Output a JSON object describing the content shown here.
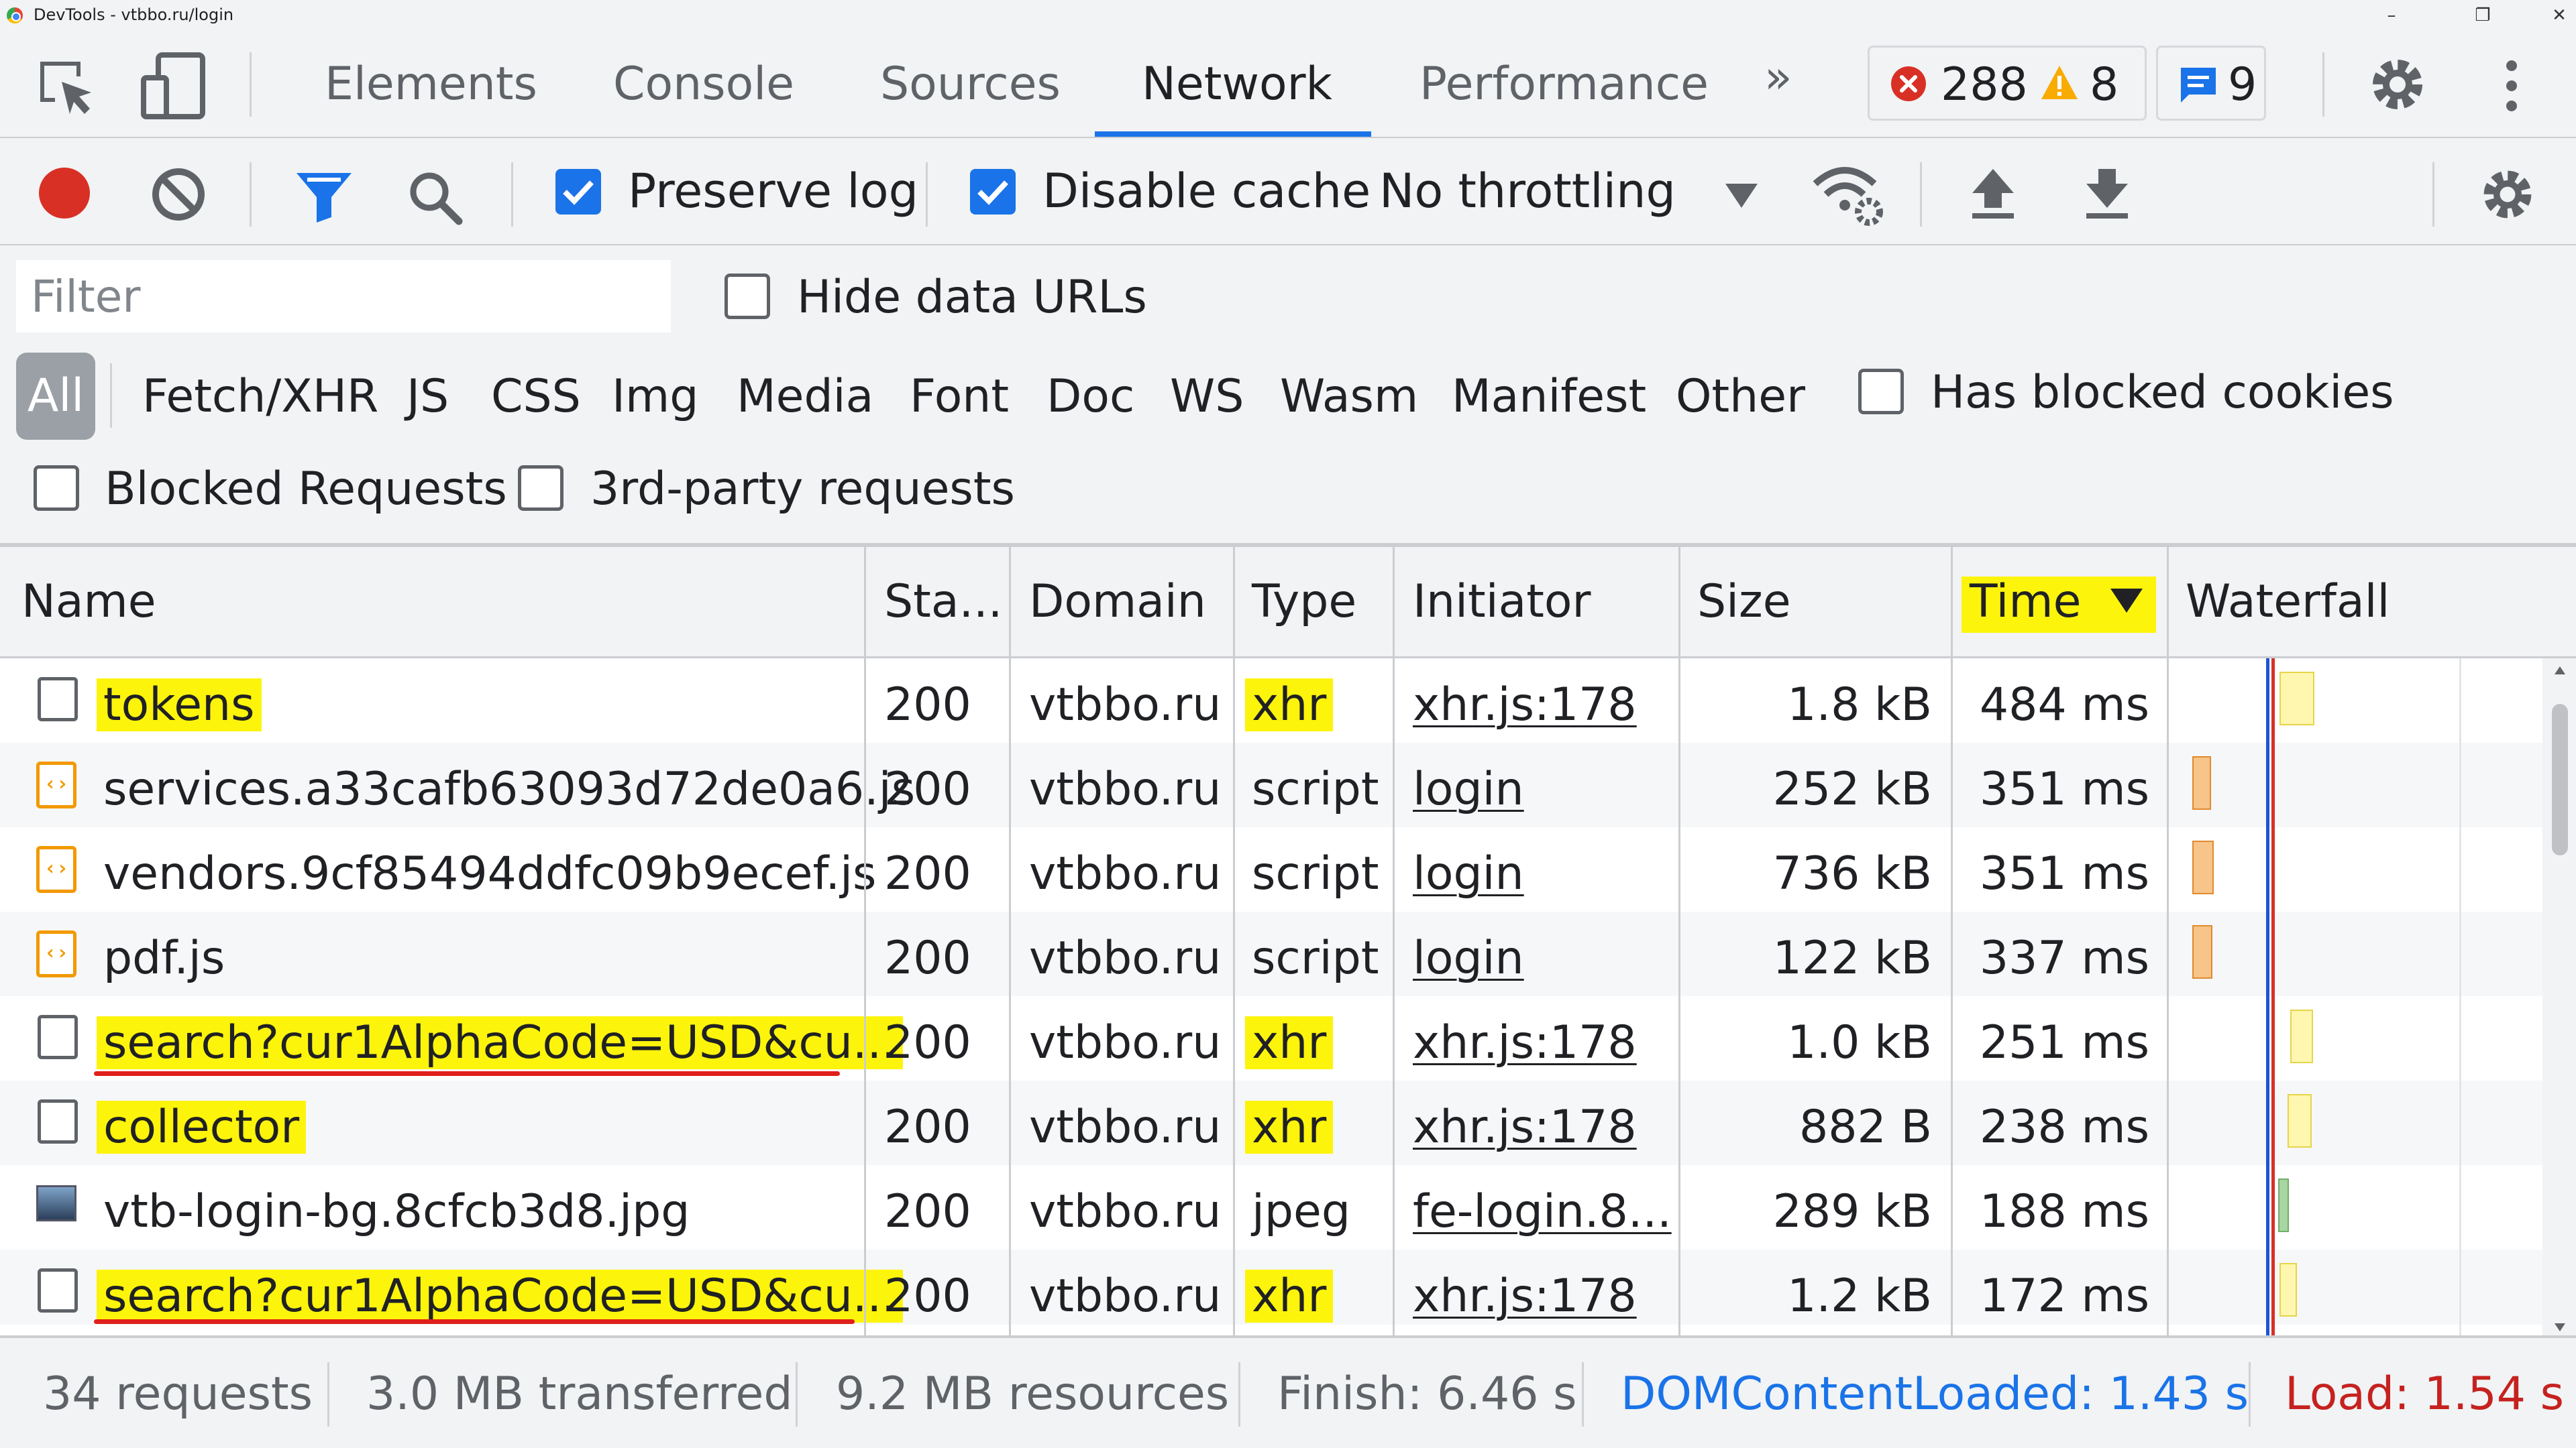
{
  "window": {
    "title": "DevTools - vtbbo.ru/login"
  },
  "tabs": {
    "elements": "Elements",
    "console": "Console",
    "sources": "Sources",
    "network": "Network",
    "performance": "Performance",
    "more": "»"
  },
  "badges": {
    "errors": "288",
    "warnings": "8",
    "messages": "9"
  },
  "toolbar": {
    "preserve_log": "Preserve log",
    "disable_cache": "Disable cache",
    "throttling": "No throttling"
  },
  "filter": {
    "placeholder": "Filter",
    "hide_data_urls": "Hide data URLs",
    "types": [
      "All",
      "Fetch/XHR",
      "JS",
      "CSS",
      "Img",
      "Media",
      "Font",
      "Doc",
      "WS",
      "Wasm",
      "Manifest",
      "Other"
    ],
    "has_blocked_cookies": "Has blocked cookies",
    "blocked_requests": "Blocked Requests",
    "third_party": "3rd-party requests"
  },
  "columns": {
    "name": "Name",
    "status": "Sta...",
    "domain": "Domain",
    "type": "Type",
    "initiator": "Initiator",
    "size": "Size",
    "time": "Time",
    "waterfall": "Waterfall"
  },
  "rows": [
    {
      "name": "tokens",
      "status": "200",
      "domain": "vtbbo.ru",
      "type": "xhr",
      "initiator": "xhr.js:178",
      "size": "1.8 kB",
      "time": "484 ms"
    },
    {
      "name": "services.a33cafb63093d72de0a6.js",
      "status": "200",
      "domain": "vtbbo.ru",
      "type": "script",
      "initiator": "login",
      "size": "252 kB",
      "time": "351 ms"
    },
    {
      "name": "vendors.9cf85494ddfc09b9ecef.js",
      "status": "200",
      "domain": "vtbbo.ru",
      "type": "script",
      "initiator": "login",
      "size": "736 kB",
      "time": "351 ms"
    },
    {
      "name": "pdf.js",
      "status": "200",
      "domain": "vtbbo.ru",
      "type": "script",
      "initiator": "login",
      "size": "122 kB",
      "time": "337 ms"
    },
    {
      "name": "search?cur1AlphaCode=USD&cu...",
      "status": "200",
      "domain": "vtbbo.ru",
      "type": "xhr",
      "initiator": "xhr.js:178",
      "size": "1.0 kB",
      "time": "251 ms"
    },
    {
      "name": "collector",
      "status": "200",
      "domain": "vtbbo.ru",
      "type": "xhr",
      "initiator": "xhr.js:178",
      "size": "882 B",
      "time": "238 ms"
    },
    {
      "name": "vtb-login-bg.8cfcb3d8.jpg",
      "status": "200",
      "domain": "vtbbo.ru",
      "type": "jpeg",
      "initiator": "fe-login.8...",
      "size": "289 kB",
      "time": "188 ms"
    },
    {
      "name": "search?cur1AlphaCode=USD&cu...",
      "status": "200",
      "domain": "vtbbo.ru",
      "type": "xhr",
      "initiator": "xhr.js:178",
      "size": "1.2 kB",
      "time": "172 ms"
    }
  ],
  "status": {
    "requests": "34 requests",
    "transferred": "3.0 MB transferred",
    "resources": "9.2 MB resources",
    "finish": "Finish: 6.46 s",
    "dcl": "DOMContentLoaded: 1.43 s",
    "load": "Load: 1.54 s"
  },
  "colors": {
    "accent": "#1a73e8",
    "highlight": "#fdf40b",
    "error": "#d93025",
    "warning": "#f9ab00",
    "script": "#f29900",
    "xhr_bar": "#fff3a0",
    "script_bar": "#f7c48a",
    "img_bar": "#a8d5a2"
  }
}
